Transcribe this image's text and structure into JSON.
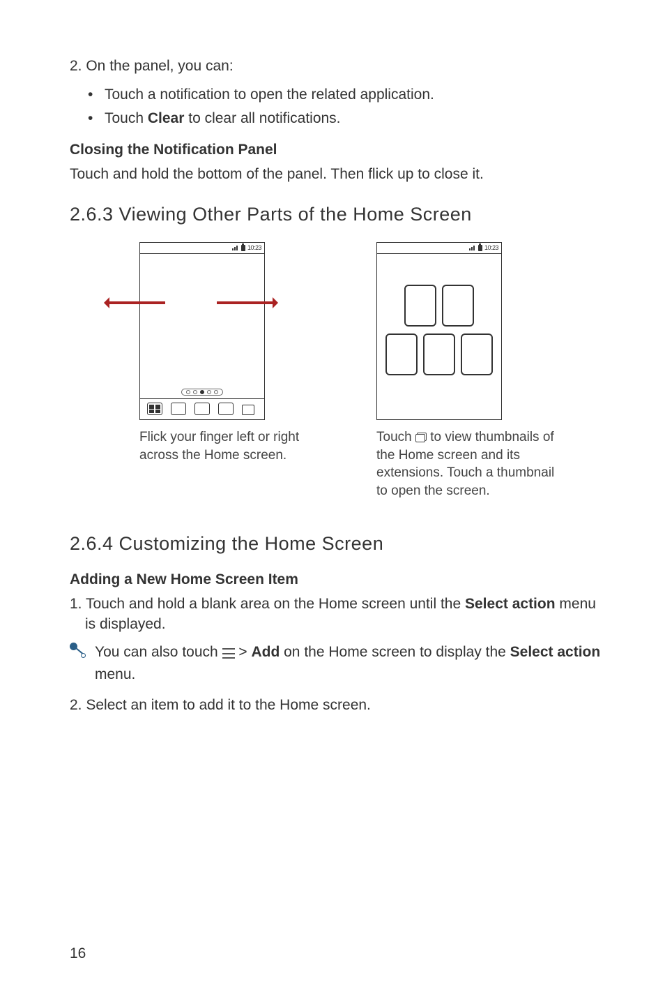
{
  "step2_intro": "2. On the panel, you can:",
  "bullets": {
    "b1": "Touch a notification to open the related application.",
    "b2_pre": "Touch ",
    "b2_bold": "Clear",
    "b2_post": " to clear all notifications."
  },
  "close_heading": "Closing the Notification Panel",
  "close_para": "Touch and hold the bottom of the panel. Then flick up to close it.",
  "sec263": "2.6.3  Viewing Other Parts of the Home Screen",
  "status_time": "10:23",
  "caption_left": "Flick your finger left or right across the Home screen.",
  "caption_right_pre": "Touch ",
  "caption_right_post": " to view thumbnails of the Home screen and its extensions. Touch a thumbnail to open the screen.",
  "sec264": "2.6.4  Customizing the Home Screen",
  "add_heading": "Adding a New Home Screen Item",
  "step1_pre": "1. Touch and hold a blank area on the Home screen until the ",
  "step1_bold": "Select action",
  "step1_post": " menu is displayed.",
  "tip_pre": "You can also touch ",
  "tip_mid1": "  > ",
  "tip_bold1": "Add",
  "tip_mid2": " on the Home screen to display the ",
  "tip_bold2": "Select action",
  "tip_post": " menu.",
  "step2_select": "2. Select an item to add it to the Home screen.",
  "page_number": "16"
}
